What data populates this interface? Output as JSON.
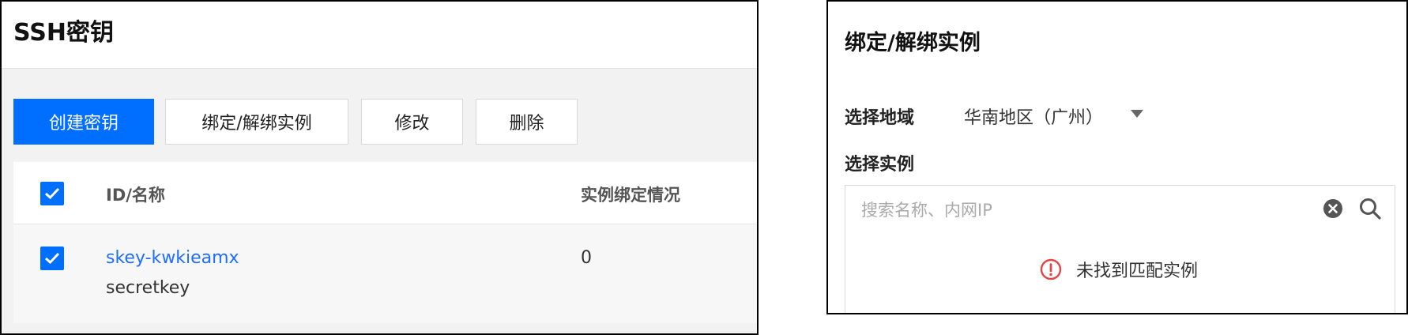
{
  "left": {
    "title": "SSH密钥",
    "toolbar": {
      "create_label": "创建密钥",
      "bind_label": "绑定/解绑实例",
      "edit_label": "修改",
      "delete_label": "删除"
    },
    "table": {
      "headers": {
        "id_name": "ID/名称",
        "binding": "实例绑定情况"
      },
      "header_checked": true,
      "rows": [
        {
          "checked": true,
          "id": "skey-kwkieamx",
          "name": "secretkey",
          "bound_count": "0"
        }
      ]
    },
    "accent_color": "#006eff"
  },
  "right": {
    "title": "绑定/解绑实例",
    "region_label": "选择地域",
    "region_value": "华南地区（广州）",
    "instance_label": "选择实例",
    "search_placeholder": "搜索名称、内网IP",
    "empty_message": "未找到匹配实例",
    "icons": {
      "clear": "clear-circle-icon",
      "search": "search-icon",
      "warning": "warning-circle-icon"
    },
    "warning_color": "#e54545"
  }
}
